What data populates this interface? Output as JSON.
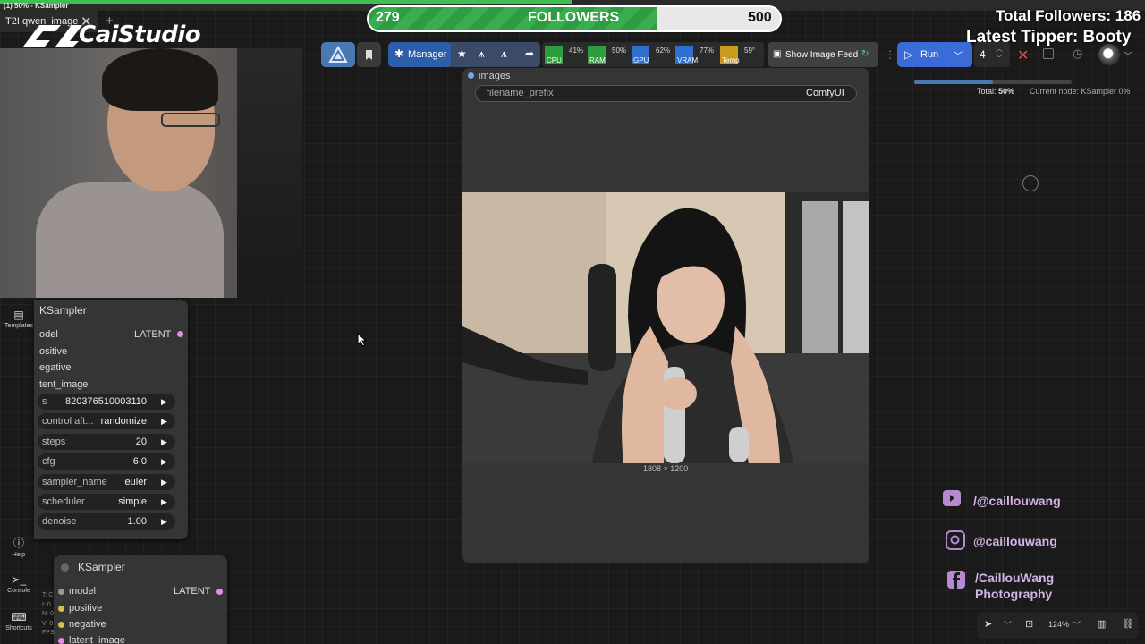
{
  "window": {
    "title": "(1) 50% - KSampler",
    "tab_label": "T2I qwen_image",
    "tab_close": "✕",
    "tab_add": "+",
    "progress_fraction": 0.5
  },
  "overlay": {
    "logo_text": "CaiStudio",
    "followers_current": "279",
    "followers_label": "FOLLOWERS",
    "followers_goal": "500",
    "total_followers": "Total Followers: 186",
    "latest_tipper": "Latest Tipper: Booty",
    "social": [
      {
        "icon": "youtube-icon",
        "text": "/@caillouwang",
        "color": "#b58ad0"
      },
      {
        "icon": "instagram-icon",
        "text": "@caillouwang",
        "color": "#b58ad0"
      },
      {
        "icon": "facebook-icon",
        "text": "/CaillouWang",
        "text2": "Photography",
        "color": "#b58ad0"
      }
    ]
  },
  "toolbar": {
    "manager_label": "Manager",
    "meters": [
      {
        "label": "CPU",
        "pct": "41%",
        "color": "#2e9d3c"
      },
      {
        "label": "RAM",
        "pct": "50%",
        "color": "#2e9d3c"
      },
      {
        "label": "GPU",
        "pct": "62%",
        "color": "#2e6fd0"
      },
      {
        "label": "VRAM",
        "pct": "77%",
        "color": "#2e6fd0"
      },
      {
        "label": "Temp",
        "pct": "59°",
        "color": "#c99a1e"
      }
    ],
    "image_feed_label": "Show Image Feed",
    "run_label": "Run",
    "batch_count": "4"
  },
  "queue": {
    "total_label": "Total:",
    "total_value": "50%",
    "current_label": "Current node: KSampler 0%",
    "progress_fraction": 0.5
  },
  "sidebar": {
    "templates_label": "Templates",
    "help_label": "Help",
    "console_label": "Console",
    "shortcuts_label": "Shortcuts"
  },
  "ksampler1": {
    "title": "KSampler",
    "inputs": [
      "odel",
      "ositive",
      "egative",
      "tent_image"
    ],
    "output": "LATENT",
    "widgets": [
      {
        "name": "s",
        "value": "820376510003110"
      },
      {
        "name": "control aft...",
        "value": "randomize"
      },
      {
        "name": "steps",
        "value": "20"
      },
      {
        "name": "cfg",
        "value": "6.0"
      },
      {
        "name": "sampler_name",
        "value": "euler"
      },
      {
        "name": "scheduler",
        "value": "simple"
      },
      {
        "name": "denoise",
        "value": "1.00"
      }
    ]
  },
  "ksampler2": {
    "title": "KSampler",
    "inputs": [
      "model",
      "positive",
      "negative",
      "latent_image"
    ],
    "output": "LATENT",
    "clipped_text": [
      "T: C",
      "I: 0",
      "N: 0",
      "V: 0",
      "FPS"
    ]
  },
  "save_image": {
    "output_label": "images",
    "widget_name": "filename_prefix",
    "widget_value": "ComfyUI",
    "image_size": "1808 × 1200"
  },
  "canvas_controls": {
    "zoom": "124%"
  }
}
